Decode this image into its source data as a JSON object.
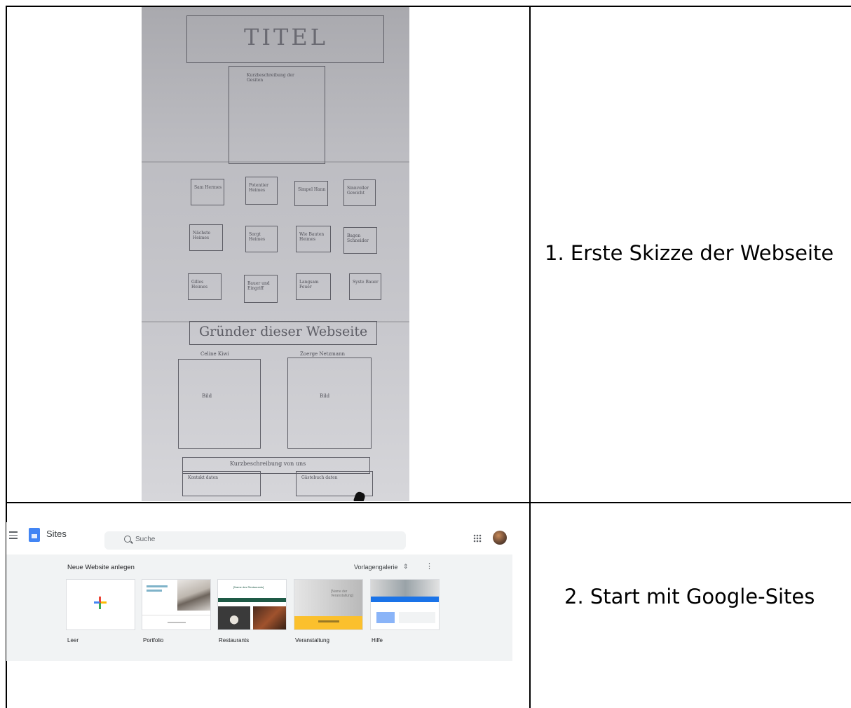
{
  "rows": [
    {
      "caption": "1. Erste Skizze der Webseite",
      "sketch": {
        "title": "TITEL",
        "intro_box": "Kurzbeschreibung der Gesiten",
        "grid_labels": [
          [
            "Sam Hermes",
            "Potentier Heimes",
            "Simpel Hann",
            "Sinnvoller Gewicht"
          ],
          [
            "Nächste Heimes",
            "Sorgt Heimes",
            "Wie Bauten Heimes",
            "Bagen Schneider"
          ],
          [
            "Gilles Heimes",
            "Bauer und Eingriff",
            "Langsam Feuer",
            "Syste Bauer"
          ]
        ],
        "founders_heading": "Gründer dieser Webseite",
        "founder_names": [
          "Celine Kiwi",
          "Zoerge Netzmann"
        ],
        "image_label": "Bild",
        "footer_bar": "Kurzbeschreibung von uns",
        "footer_left": "Kontakt daten",
        "footer_right": "Gästebuch daten"
      }
    },
    {
      "caption": "2. Start mit Google-Sites",
      "google_sites": {
        "app_name": "Sites",
        "search_placeholder": "Suche",
        "new_site_label": "Neue Website anlegen",
        "template_gallery": "Vorlagengalerie",
        "templates": [
          {
            "label": "Leer"
          },
          {
            "label": "Portfolio"
          },
          {
            "label": "Restaurants",
            "preview_title": "[Name des Restaurants]"
          },
          {
            "label": "Veranstaltung",
            "preview_title": "[Name der Veranstaltung]"
          },
          {
            "label": "Hilfe"
          }
        ]
      }
    }
  ]
}
